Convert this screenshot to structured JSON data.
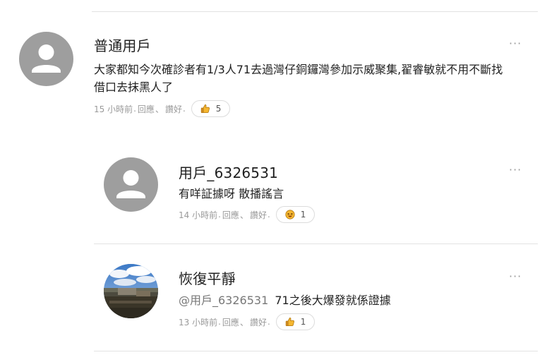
{
  "comments": [
    {
      "username": "普通用戶",
      "text_line1": "大家都知今次確診者有1/3人71去過灣仔銅鑼灣參加示威聚集,翟睿敏就不用不斷找",
      "text_line2": "借口去抹黑人了",
      "time": "15 小時前",
      "reply_label": "回應",
      "praise_label": "讚好",
      "reaction_icon": "thumbs-up-emoji",
      "reaction_count": "5",
      "more_label": "···"
    },
    {
      "username": "用戶_6326531",
      "text": "有咩証據呀 散播謠言",
      "time": "14 小時前",
      "reply_label": "回應",
      "praise_label": "讚好",
      "reaction_icon": "laughing-emoji",
      "reaction_count": "1",
      "more_label": "···"
    },
    {
      "username": "恢復平靜",
      "mention": "@用戶_6326531",
      "text": "71之後大爆發就係證據",
      "time": "13 小時前",
      "reply_label": "回應",
      "praise_label": "讚好",
      "reaction_icon": "thumbs-up-emoji",
      "reaction_count": "1",
      "more_label": "···"
    }
  ],
  "colors": {
    "avatar_default": "#9e9e9e",
    "text_primary": "#1f1f1f",
    "text_meta": "#9a9a9a",
    "divider": "#e2e2e2"
  }
}
